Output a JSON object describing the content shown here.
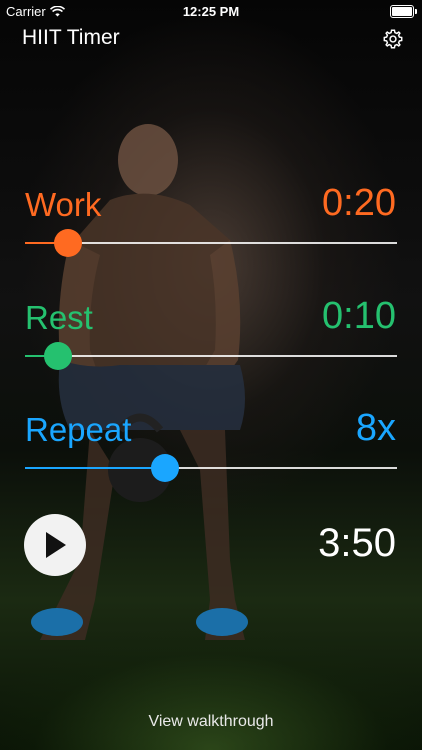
{
  "status_bar": {
    "carrier": "Carrier",
    "time": "12:25 PM"
  },
  "nav": {
    "title": "HIIT Timer",
    "settings_icon": "gear-icon"
  },
  "settings": [
    {
      "label": "Work",
      "value": "0:20",
      "color": "#ff6a21",
      "slider_level": 0.115
    },
    {
      "label": "Rest",
      "value": "0:10",
      "color": "#25c16f",
      "slider_level": 0.088
    },
    {
      "label": "Repeat",
      "value": "8x",
      "color": "#1aa6ff",
      "slider_level": 0.376
    }
  ],
  "total_time": "3:50",
  "play_icon": "play-icon",
  "walkthrough_link": "View walkthrough"
}
